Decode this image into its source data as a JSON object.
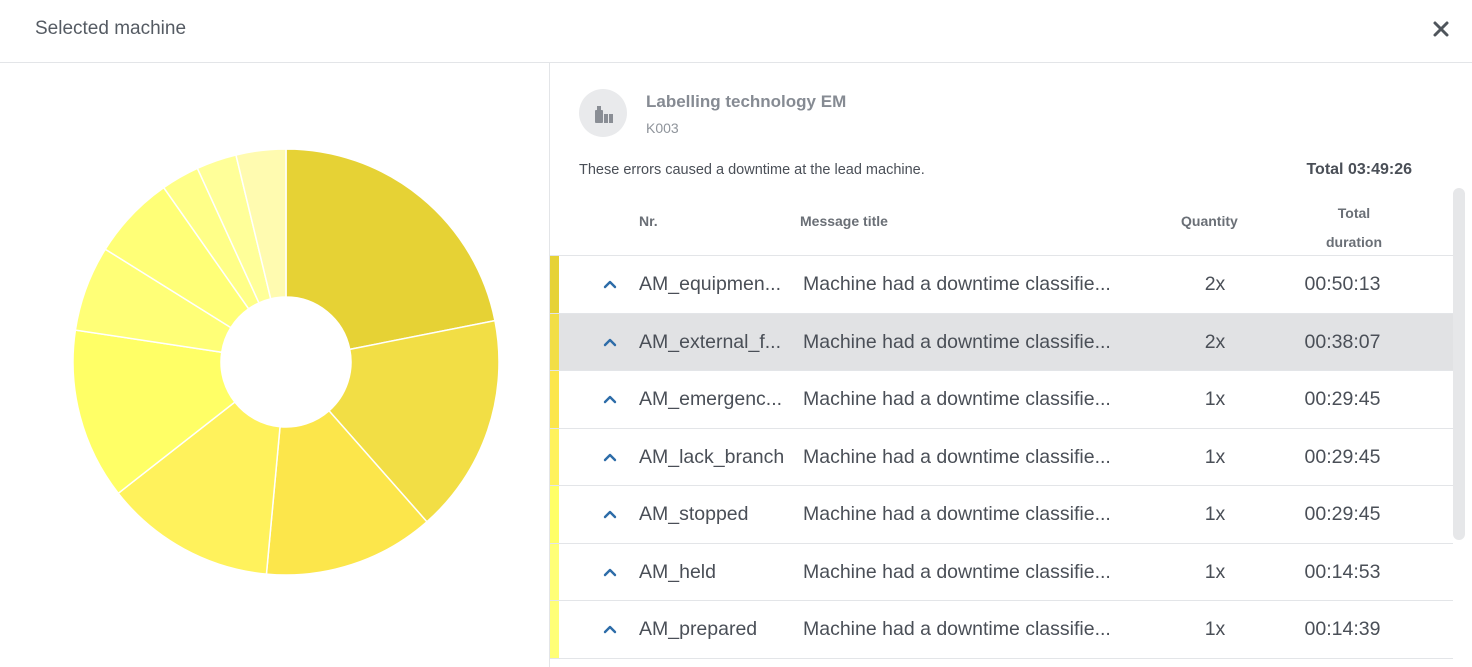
{
  "header": {
    "title": "Selected machine",
    "close_icon": "close-icon"
  },
  "machine": {
    "icon": "machine-icon",
    "name": "Labelling technology EM",
    "id": "K003"
  },
  "summary": {
    "text": "These errors caused a downtime at the lead machine.",
    "total": "Total 03:49:26"
  },
  "table": {
    "columns": {
      "nr": "Nr.",
      "title": "Message title",
      "quantity": "Quantity",
      "duration_line1": "Total",
      "duration_line2": "duration"
    },
    "rows": [
      {
        "nr": "AM_equipmen...",
        "title": "Machine had a downtime classifie...",
        "quantity": "2x",
        "duration": "00:50:13",
        "color": "#e6d235"
      },
      {
        "nr": "AM_external_f...",
        "title": "Machine had a downtime classifie...",
        "quantity": "2x",
        "duration": "00:38:07",
        "color": "#f2de45",
        "selected": true
      },
      {
        "nr": "AM_emergenc...",
        "title": "Machine had a downtime classifie...",
        "quantity": "1x",
        "duration": "00:29:45",
        "color": "#fce64b"
      },
      {
        "nr": "AM_lack_branch",
        "title": "Machine had a downtime classifie...",
        "quantity": "1x",
        "duration": "00:29:45",
        "color": "#fff25c"
      },
      {
        "nr": "AM_stopped",
        "title": "Machine had a downtime classifie...",
        "quantity": "1x",
        "duration": "00:29:45",
        "color": "#ffff66"
      },
      {
        "nr": "AM_held",
        "title": "Machine had a downtime classifie...",
        "quantity": "1x",
        "duration": "00:14:53",
        "color": "#ffff77"
      },
      {
        "nr": "AM_prepared",
        "title": "Machine had a downtime classifie...",
        "quantity": "1x",
        "duration": "00:14:39",
        "color": "#ffff77"
      }
    ]
  },
  "chart_data": {
    "type": "pie",
    "donut": true,
    "categories": [
      "AM_equipmen...",
      "AM_external_f...",
      "AM_emergenc...",
      "AM_lack_branch",
      "AM_stopped",
      "AM_held",
      "AM_prepared",
      "slice-8",
      "slice-9",
      "slice-10"
    ],
    "values": [
      3013,
      2287,
      1785,
      1785,
      1785,
      893,
      879,
      400,
      420,
      520
    ],
    "colors": [
      "#e6d235",
      "#f2de45",
      "#fce64b",
      "#fff25c",
      "#ffff66",
      "#ffff77",
      "#ffff77",
      "#ffff88",
      "#ffff99",
      "#fffbb0"
    ]
  }
}
